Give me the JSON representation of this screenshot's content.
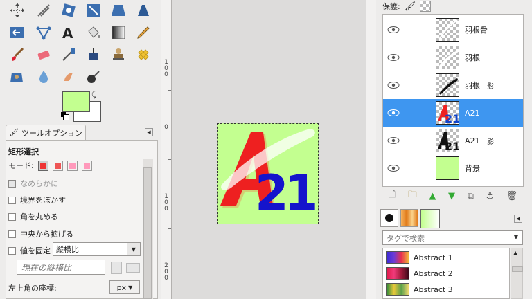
{
  "toolbox": {
    "tools_row1": [
      "move-tool-icon",
      "shear-tool-icon",
      "cage-tool-icon",
      "scale-tool-icon",
      "perspective-tool-icon",
      "flip-tool-icon"
    ],
    "colors": {
      "foreground": "#c3ff90",
      "background": "#ffffff"
    }
  },
  "tool_options": {
    "tab_label": "ツールオプション",
    "tool_name": "矩形選択",
    "mode_label": "モード:",
    "antialias_label": "なめらかに",
    "feather_label": "境界をぼかす",
    "rounded_label": "角を丸める",
    "expand_center_label": "中央から拡げる",
    "fixed_label": "値を固定",
    "fixed_mode_value": "縦横比",
    "aspect_entry_value": "現在の縦横比",
    "position_label": "左上角の座標:",
    "unit_value": "px"
  },
  "rulers": {
    "left_labels": [
      "1",
      "0",
      "0",
      "0",
      "1",
      "0",
      "0",
      "2",
      "0",
      "0"
    ]
  },
  "dock": {
    "lock_label": "保護:",
    "layers": [
      {
        "name": "羽根骨",
        "chain": false,
        "selected": false
      },
      {
        "name": "羽根",
        "chain": false,
        "selected": false
      },
      {
        "name": "羽根",
        "chain": true,
        "selected": false
      },
      {
        "name": "A21",
        "chain": false,
        "selected": true
      },
      {
        "name": "A21",
        "chain": true,
        "selected": false
      },
      {
        "name": "背景",
        "chain": false,
        "selected": false
      }
    ],
    "chain_glyph": "影",
    "tag_search_placeholder": "タグで検索",
    "gradients": [
      {
        "name": "Abstract 1"
      },
      {
        "name": "Abstract 2"
      },
      {
        "name": "Abstract 3"
      }
    ]
  },
  "image_text": "A21"
}
